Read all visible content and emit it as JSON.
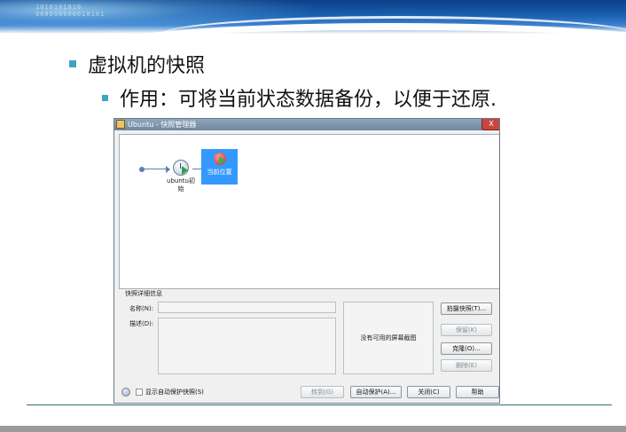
{
  "slide": {
    "bullet1": "虚拟机的快照",
    "bullet2": "作用：可将当前状态数据备份，以便于还原."
  },
  "window": {
    "title": "Ubuntu - 快照管理器",
    "close_glyph": "X",
    "snapshot_label": "ubuntu初始",
    "current_label": "当前位置",
    "details_heading": "快照详细信息",
    "name_label": "名称(N):",
    "desc_label": "描述(D):",
    "screenshot_text": "没有可用的屏幕截图",
    "buttons": {
      "take": "拍摄快照(T)...",
      "keep": "保留(K)",
      "clone": "克隆(O)...",
      "delete": "删除(E)",
      "goto": "转到(G)",
      "autoprotect": "自动保护(A)...",
      "close": "关闭(C)",
      "help": "帮助"
    },
    "show_autoprotect_label": "显示自动保护快照(S)"
  },
  "header": {
    "binary_text": "1010101010\n000000000010101"
  },
  "icons": {
    "window_icon": "vm-icon",
    "snapshot": "clock-icon",
    "current": "current-state-icon",
    "help": "help-icon"
  }
}
